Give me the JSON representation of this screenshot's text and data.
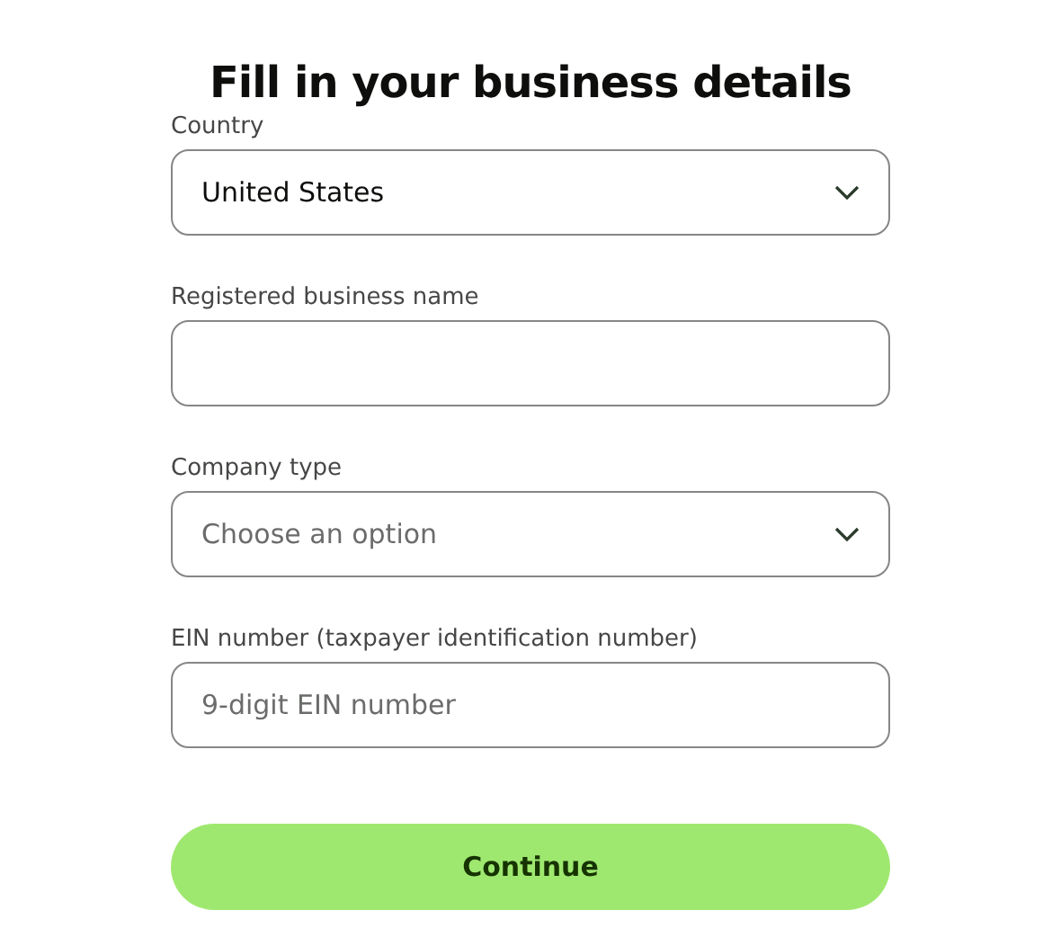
{
  "title": "Fill in your business details",
  "fields": [
    {
      "kind": "select",
      "label": "Country",
      "value": "United States"
    },
    {
      "kind": "text",
      "label": "Registered business name"
    },
    {
      "kind": "select",
      "label": "Company type",
      "placeholder": "Choose an option"
    },
    {
      "kind": "text",
      "label": "EIN number (taxpayer identification number)",
      "placeholder": "9-digit EIN number"
    }
  ],
  "button": "Continue"
}
